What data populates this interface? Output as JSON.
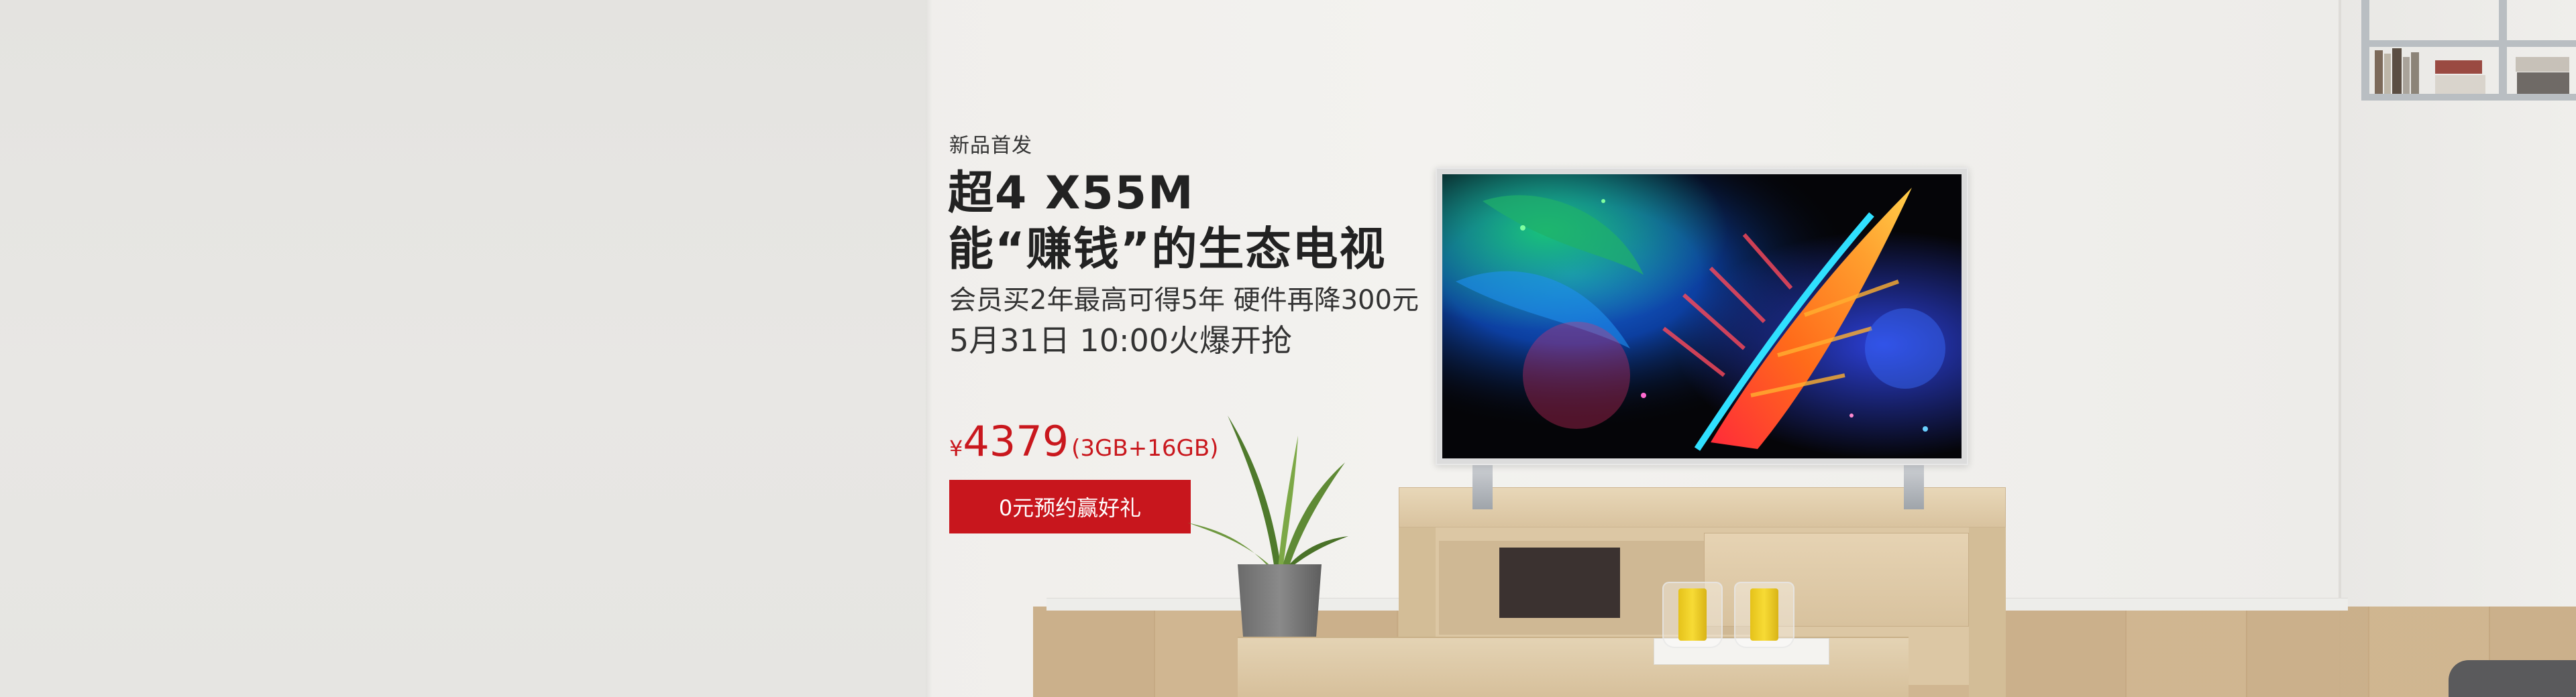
{
  "promo": {
    "tag": "新品首发",
    "title_line1": "超4 X55M",
    "title_line2": "能“赚钱”的生态电视",
    "subtitle_line1": "会员买2年最高可得5年 硬件再降300元",
    "subtitle_line2": "5月31日  10:00火爆开抢",
    "price": {
      "currency": "¥",
      "amount": "4379",
      "spec": "(3GB+16GB)"
    },
    "cta_label": "0元预约赢好礼"
  },
  "colors": {
    "accent": "#c8161d",
    "price": "#c9171d",
    "text_dark": "#222222"
  },
  "icons": [
    "television-image",
    "plant-image",
    "candle-image"
  ]
}
